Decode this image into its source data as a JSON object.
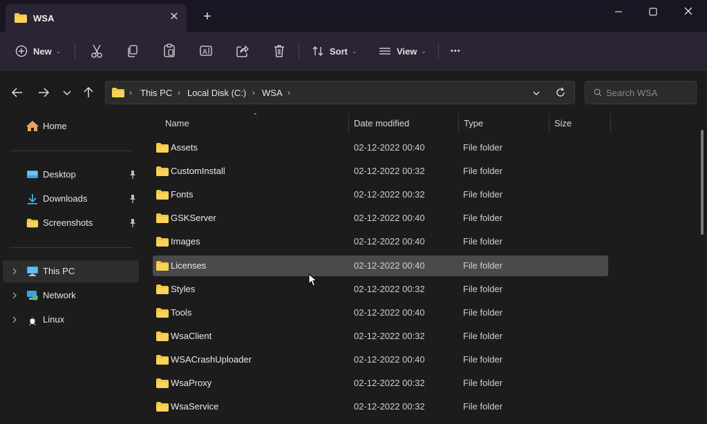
{
  "window": {
    "tab_title": "WSA",
    "new_tab_label": "+"
  },
  "toolbar": {
    "new_label": "New",
    "sort_label": "Sort",
    "view_label": "View",
    "more_label": "•••"
  },
  "address": {
    "crumbs": [
      "This PC",
      "Local Disk (C:)",
      "WSA"
    ]
  },
  "search": {
    "placeholder": "Search WSA"
  },
  "sidebar": {
    "home": "Home",
    "quick": [
      {
        "label": "Desktop",
        "icon": "desktop-icon"
      },
      {
        "label": "Downloads",
        "icon": "download-icon"
      },
      {
        "label": "Screenshots",
        "icon": "folder-icon"
      }
    ],
    "tree": [
      {
        "label": "This PC",
        "icon": "computer-icon"
      },
      {
        "label": "Network",
        "icon": "network-icon"
      },
      {
        "label": "Linux",
        "icon": "linux-icon"
      }
    ]
  },
  "columns": {
    "name": "Name",
    "date": "Date modified",
    "type": "Type",
    "size": "Size"
  },
  "files": [
    {
      "name": "Assets",
      "date": "02-12-2022 00:40",
      "type": "File folder"
    },
    {
      "name": "CustomInstall",
      "date": "02-12-2022 00:32",
      "type": "File folder"
    },
    {
      "name": "Fonts",
      "date": "02-12-2022 00:32",
      "type": "File folder"
    },
    {
      "name": "GSKServer",
      "date": "02-12-2022 00:40",
      "type": "File folder"
    },
    {
      "name": "Images",
      "date": "02-12-2022 00:40",
      "type": "File folder"
    },
    {
      "name": "Licenses",
      "date": "02-12-2022 00:40",
      "type": "File folder"
    },
    {
      "name": "Styles",
      "date": "02-12-2022 00:32",
      "type": "File folder"
    },
    {
      "name": "Tools",
      "date": "02-12-2022 00:40",
      "type": "File folder"
    },
    {
      "name": "WsaClient",
      "date": "02-12-2022 00:32",
      "type": "File folder"
    },
    {
      "name": "WSACrashUploader",
      "date": "02-12-2022 00:40",
      "type": "File folder"
    },
    {
      "name": "WsaProxy",
      "date": "02-12-2022 00:32",
      "type": "File folder"
    },
    {
      "name": "WsaService",
      "date": "02-12-2022 00:32",
      "type": "File folder"
    }
  ],
  "colors": {
    "folder": "#f2c744",
    "selected_row": "#4a4a4a",
    "titlebar": "#1a1522",
    "toolbar": "#2a2434"
  }
}
